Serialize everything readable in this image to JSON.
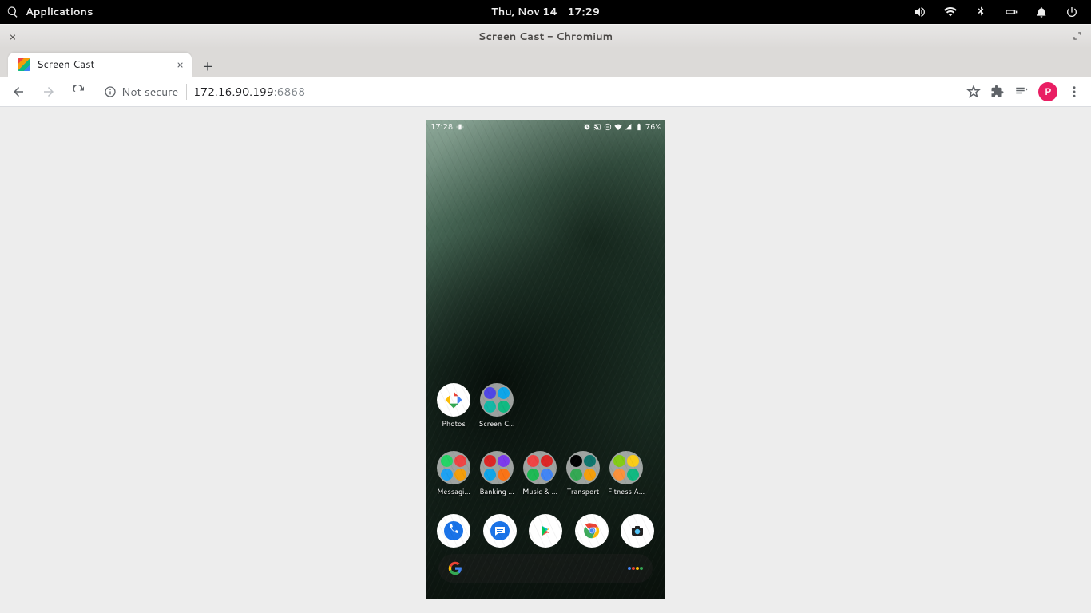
{
  "gnome": {
    "apps_label": "Applications",
    "date": "Thu, Nov 14",
    "time": "17:29"
  },
  "window": {
    "title": "Screen Cast - Chromium"
  },
  "browser": {
    "tab_title": "Screen Cast",
    "security_label": "Not secure",
    "address_host": "172.16.90.199",
    "address_port": ":6868",
    "profile_initial": "P"
  },
  "phone": {
    "status": {
      "time": "17:28",
      "battery": "76%"
    },
    "row1": [
      {
        "label": "Photos",
        "type": "app",
        "colors": [
          "#ea4335",
          "#fbbc05",
          "#34a853",
          "#4285f4"
        ]
      },
      {
        "label": "Screen C…",
        "type": "folder",
        "minis": [
          "#4f46e5",
          "#0ea5e9",
          "#14b8a6",
          "#10b981"
        ]
      }
    ],
    "row2": [
      {
        "label": "Messagi…",
        "minis": [
          "#25d366",
          "#ef4444",
          "#1da1f2",
          "#f59e0b"
        ]
      },
      {
        "label": "Banking …",
        "minis": [
          "#dc2626",
          "#7c3aed",
          "#0ea5e9",
          "#f97316"
        ]
      },
      {
        "label": "Music & …",
        "minis": [
          "#ef4444",
          "#dc2626",
          "#1db954",
          "#4285f4"
        ]
      },
      {
        "label": "Transport",
        "minis": [
          "#000000",
          "#0f766e",
          "#34a853",
          "#f59e0b"
        ]
      },
      {
        "label": "Fitness A…",
        "minis": [
          "#84cc16",
          "#facc15",
          "#fb923c",
          "#10b981"
        ]
      }
    ],
    "dock": [
      "phone",
      "messages",
      "play",
      "chrome",
      "camera"
    ]
  }
}
